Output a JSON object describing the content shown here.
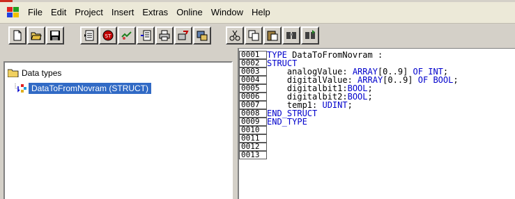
{
  "menubar": {
    "items": [
      "File",
      "Edit",
      "Project",
      "Insert",
      "Extras",
      "Online",
      "Window",
      "Help"
    ]
  },
  "toolbar": {
    "icons": [
      "new-file-icon",
      "open-file-icon",
      "save-icon",
      "read-file-icon",
      "stop-icon",
      "login-icon",
      "plc-icon",
      "print-icon",
      "export-icon",
      "monitor-icon",
      "cut-icon",
      "copy-icon",
      "paste-icon",
      "find-icon",
      "find-next-icon"
    ]
  },
  "tree": {
    "root_label": "Data types",
    "child_label": "DataToFromNovram (STRUCT)"
  },
  "editor": {
    "lines": [
      {
        "num": "0001",
        "segments": [
          {
            "text": "TYPE",
            "kw": true
          },
          {
            "text": " DataToFromNovram :",
            "kw": false
          }
        ]
      },
      {
        "num": "0002",
        "segments": [
          {
            "text": "STRUCT",
            "kw": true
          }
        ]
      },
      {
        "num": "0003",
        "segments": [
          {
            "text": "    analogValue: ",
            "kw": false
          },
          {
            "text": "ARRAY",
            "kw": true
          },
          {
            "text": "[0..9] ",
            "kw": false
          },
          {
            "text": "OF",
            "kw": true
          },
          {
            "text": " ",
            "kw": false
          },
          {
            "text": "INT",
            "kw": true
          },
          {
            "text": ";",
            "kw": false
          }
        ]
      },
      {
        "num": "0004",
        "segments": [
          {
            "text": "    digitalValue: ",
            "kw": false
          },
          {
            "text": "ARRAY",
            "kw": true
          },
          {
            "text": "[0..9] ",
            "kw": false
          },
          {
            "text": "OF",
            "kw": true
          },
          {
            "text": " ",
            "kw": false
          },
          {
            "text": "BOOL",
            "kw": true
          },
          {
            "text": ";",
            "kw": false
          }
        ]
      },
      {
        "num": "0005",
        "segments": [
          {
            "text": "    digitalbit1:",
            "kw": false
          },
          {
            "text": "BOOL",
            "kw": true
          },
          {
            "text": ";",
            "kw": false
          }
        ]
      },
      {
        "num": "0006",
        "segments": [
          {
            "text": "    digitalbit2:",
            "kw": false
          },
          {
            "text": "BOOL",
            "kw": true
          },
          {
            "text": ";",
            "kw": false
          }
        ]
      },
      {
        "num": "0007",
        "segments": [
          {
            "text": "    temp1: ",
            "kw": false
          },
          {
            "text": "UDINT",
            "kw": true
          },
          {
            "text": ";",
            "kw": false
          }
        ]
      },
      {
        "num": "0008",
        "segments": [
          {
            "text": "END_STRUCT",
            "kw": true
          }
        ]
      },
      {
        "num": "0009",
        "segments": [
          {
            "text": "END_TYPE",
            "kw": true
          }
        ]
      },
      {
        "num": "0010",
        "segments": []
      },
      {
        "num": "0011",
        "segments": []
      },
      {
        "num": "0012",
        "segments": []
      },
      {
        "num": "0013",
        "segments": []
      }
    ]
  },
  "colors": {
    "keyword": "#0000cc",
    "selection": "#316ac5"
  }
}
